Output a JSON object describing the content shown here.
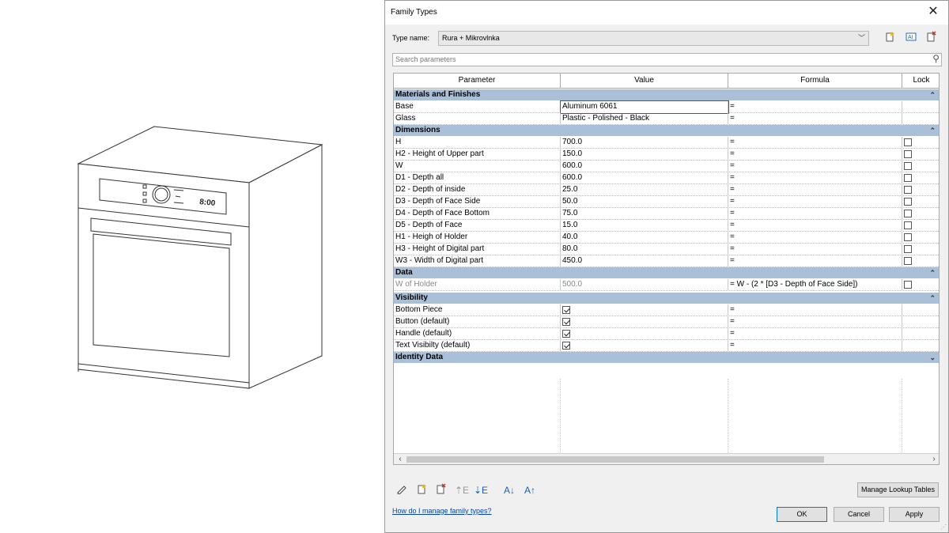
{
  "dialog": {
    "title": "Family Types",
    "close_glyph": "✕",
    "type_name_label": "Type name:",
    "type_name_value": "Rura + Mikrovlnka",
    "toolbar_icons": [
      "new-type-icon",
      "rename-type-icon",
      "delete-type-icon"
    ],
    "search_placeholder": "Search parameters",
    "columns": [
      "Parameter",
      "Value",
      "Formula",
      "Lock"
    ],
    "groups": [
      {
        "name": "Materials and Finishes",
        "collapsed": false,
        "rows": [
          {
            "param": "Base",
            "value": "Aluminum 6061",
            "formula": "=",
            "lock": null,
            "editing": true
          },
          {
            "param": "Glass",
            "value": "Plastic - Polished - Black",
            "formula": "=",
            "lock": null
          }
        ]
      },
      {
        "name": "Dimensions",
        "collapsed": false,
        "rows": [
          {
            "param": "H",
            "value": "700.0",
            "formula": "=",
            "lock": false
          },
          {
            "param": "H2 - Height of Upper part",
            "value": "150.0",
            "formula": "=",
            "lock": false
          },
          {
            "param": "W",
            "value": "600.0",
            "formula": "=",
            "lock": false
          },
          {
            "param": "D1 - Depth all",
            "value": "600.0",
            "formula": "=",
            "lock": false
          },
          {
            "param": "D2 - Depth of inside",
            "value": "25.0",
            "formula": "=",
            "lock": false
          },
          {
            "param": "D3 - Depth of Face Side",
            "value": "50.0",
            "formula": "=",
            "lock": false
          },
          {
            "param": "D4 - Depth of Face Bottom",
            "value": "75.0",
            "formula": "=",
            "lock": false
          },
          {
            "param": "D5 - Depth of Face",
            "value": "15.0",
            "formula": "=",
            "lock": false
          },
          {
            "param": "H1 - Heigh of Holder",
            "value": "40.0",
            "formula": "=",
            "lock": false
          },
          {
            "param": "H3 - Height of Digital part",
            "value": "80.0",
            "formula": "=",
            "lock": false
          },
          {
            "param": "W3 - Width of Digital part",
            "value": "450.0",
            "formula": "=",
            "lock": false
          }
        ]
      },
      {
        "name": "Data",
        "collapsed": false,
        "rows": [
          {
            "param": "W of Holder",
            "value": "500.0",
            "formula": "= W - (2 * [D3 - Depth of Face Side])",
            "lock": false,
            "disabled": true
          }
        ]
      },
      {
        "name": "Visibility",
        "collapsed": false,
        "rows": [
          {
            "param": "Bottom Piece",
            "value": true,
            "formula": "=",
            "lock": null
          },
          {
            "param": "Button (default)",
            "value": true,
            "formula": "=",
            "lock": null
          },
          {
            "param": "Handle (default)",
            "value": true,
            "formula": "=",
            "lock": null
          },
          {
            "param": "Text Visibilty (default)",
            "value": true,
            "formula": "=",
            "lock": null
          }
        ]
      },
      {
        "name": "Identity Data",
        "collapsed": true,
        "rows": []
      }
    ],
    "bottom_icons": [
      "edit-parameter-icon",
      "new-parameter-icon",
      "delete-parameter-icon",
      "move-up-icon",
      "move-down-icon",
      "sort-ascending-icon",
      "sort-descending-icon"
    ],
    "manage_lookup_label": "Manage Lookup Tables",
    "help_link": "How do I manage family types?",
    "ok_label": "OK",
    "cancel_label": "Cancel",
    "apply_label": "Apply"
  },
  "oven_panel": {
    "display_text": "8:00"
  }
}
